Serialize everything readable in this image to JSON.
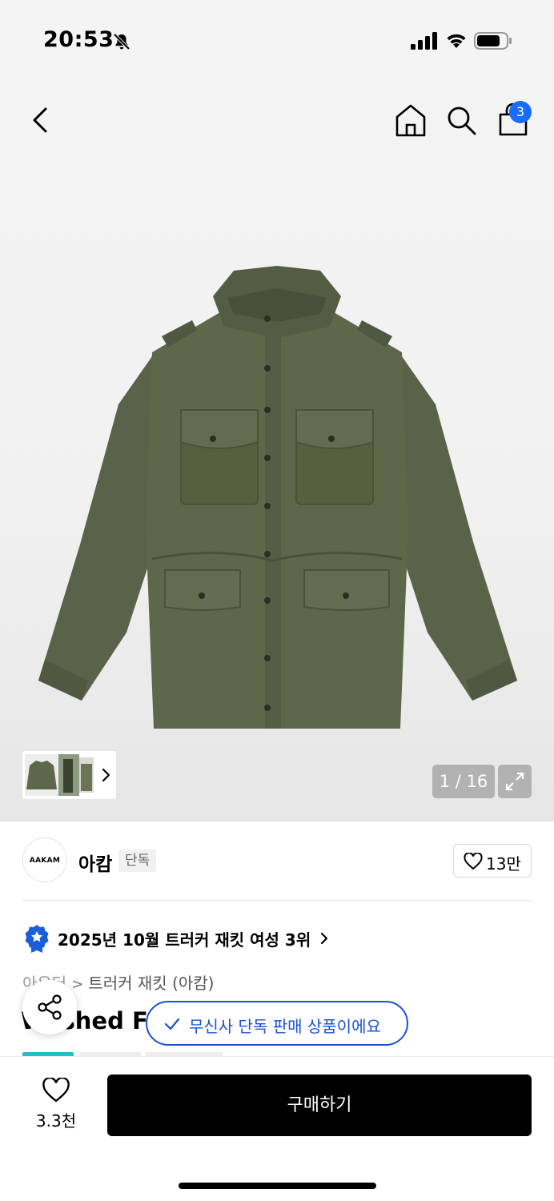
{
  "status_bar": {
    "time": "20:53",
    "icons": [
      "bell-off-icon",
      "signal-icon",
      "wifi-icon",
      "battery-icon"
    ]
  },
  "header": {
    "cart_count": "3",
    "icons": [
      "back-icon",
      "home-icon",
      "search-icon",
      "cart-icon"
    ]
  },
  "gallery": {
    "counter": "1 / 16"
  },
  "brand": {
    "logo_text": "AAKAM",
    "name": "아캄",
    "tag": "단독",
    "like_count": "13만"
  },
  "ranking": {
    "text": "2025년 10월 트러커 재킷 여성 3위"
  },
  "breadcrumb": {
    "level1": "아우터",
    "separator": ">",
    "level2": "트러커 재킷 (아캄)"
  },
  "product": {
    "title_visible": "Washed Fie"
  },
  "toast": {
    "text": "무신사 단독 판매 상품이에요"
  },
  "bottom": {
    "wish_count": "3.3천",
    "buy_label": "구매하기"
  },
  "colors": {
    "accent_blue": "#1a4fd8",
    "badge_blue": "#1a6bff",
    "tag_teal": "#20c0c8",
    "jacket_olive": "#5a6447"
  }
}
